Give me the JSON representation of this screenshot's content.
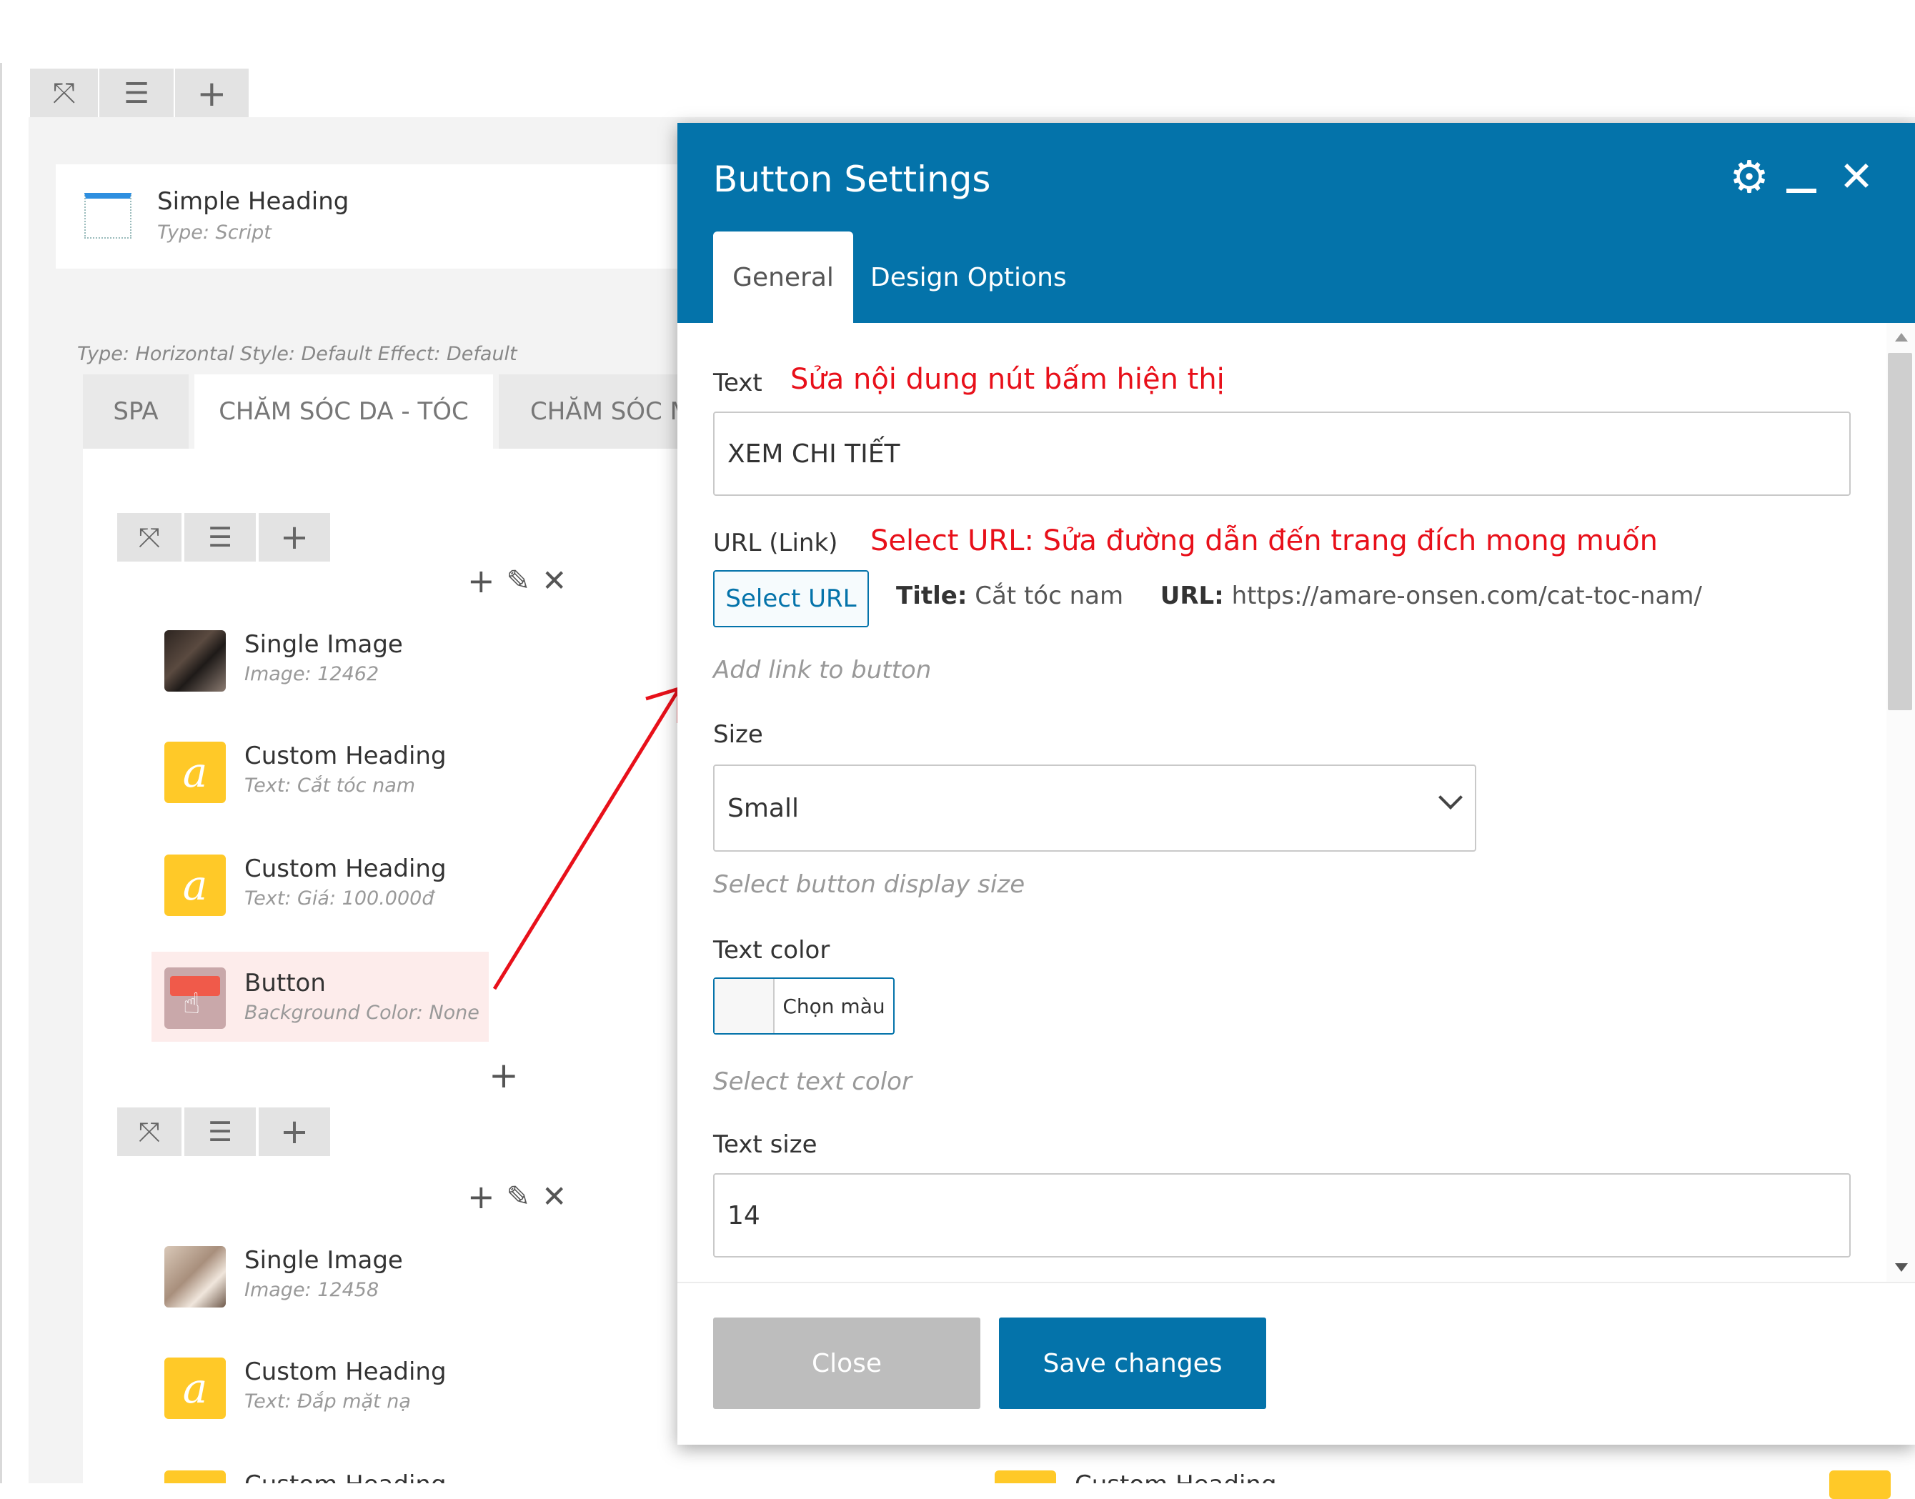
{
  "editor": {
    "simple_heading": {
      "title": "Simple Heading",
      "subtitle": "Type: Script"
    },
    "tabs_meta": "Type: Horizontal  Style: Default  Effect: Default",
    "tabs": [
      "SPA",
      "CHĂM SÓC DA - TÓC",
      "CHĂM SÓC M"
    ],
    "column1": [
      {
        "title": "Single Image",
        "subtitle": "Image: 12462",
        "icon": "photo-icon"
      },
      {
        "title": "Custom Heading",
        "subtitle": "Text: Cắt tóc nam",
        "icon": "custom-heading-icon",
        "glyph": "a"
      },
      {
        "title": "Custom Heading",
        "subtitle": "Text: Giá: 100.000đ",
        "icon": "custom-heading-icon",
        "glyph": "a"
      },
      {
        "title": "Button",
        "subtitle": "Background Color: None",
        "icon": "button-icon"
      }
    ],
    "column2": [
      {
        "title": "Single Image",
        "subtitle": "Image: 12458",
        "icon": "photo-icon"
      },
      {
        "title": "Custom Heading",
        "subtitle": "Text: Đắp mặt nạ",
        "icon": "custom-heading-icon",
        "glyph": "a"
      },
      {
        "title": "Custom Heading",
        "subtitle": "",
        "icon": "custom-heading-icon",
        "glyph": "a"
      }
    ],
    "bottom_right_item": {
      "title": "Custom Heading"
    }
  },
  "modal": {
    "title": "Button Settings",
    "tabs": {
      "general": "General",
      "design": "Design Options"
    },
    "text_field": {
      "label": "Text",
      "note": "Sửa nội dung nút bấm hiện thị",
      "value": "XEM CHI TIẾT"
    },
    "url_field": {
      "label": "URL (Link)",
      "note": "Select URL: Sửa đường dẫn đến trang đích mong muốn",
      "button": "Select URL",
      "title_key": "Title:",
      "title_value": "Cắt tóc nam",
      "url_key": "URL:",
      "url_value": "https://amare-onsen.com/cat-toc-nam/",
      "help": "Add link to button"
    },
    "size_field": {
      "label": "Size",
      "value": "Small",
      "help": "Select button display size"
    },
    "text_color": {
      "label": "Text color",
      "button": "Chọn màu",
      "help": "Select text color"
    },
    "text_size": {
      "label": "Text size",
      "value": "14"
    },
    "footer": {
      "close": "Close",
      "save": "Save changes"
    }
  },
  "colors": {
    "primary": "#0473aa",
    "annotation": "#e8101a",
    "element_accent": "#ffc928"
  }
}
